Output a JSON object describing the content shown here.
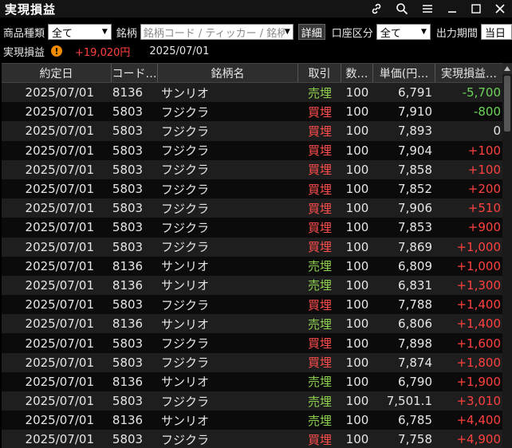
{
  "window": {
    "title": "実現損益",
    "icons": [
      "link-icon",
      "search-icon",
      "menu-icon",
      "minimize-icon",
      "maximize-icon",
      "close-icon"
    ]
  },
  "filters": {
    "product_label": "商品種類",
    "product_value": "全て",
    "symbol_label": "銘柄",
    "symbol_placeholder": "銘柄コード / ティッカー / 銘柄名",
    "detail_button": "詳細",
    "account_label": "口座区分",
    "account_value": "全て",
    "period_label": "出力期間",
    "period_value": "当日"
  },
  "summary": {
    "label": "実現損益",
    "value": "+19,020円",
    "date": "2025/07/01"
  },
  "colors": {
    "sell": "#8fd14f",
    "buy": "#ff4d4d",
    "profit": "#ff4040",
    "loss": "#6ed35a"
  },
  "table": {
    "headers": [
      "約定日",
      "コード…",
      "銘柄名",
      "取引",
      "数…",
      "単価(円…",
      "実現損益…"
    ],
    "rows": [
      {
        "date": "2025/07/01",
        "code": "8136",
        "name": "サンリオ",
        "side": "売埋",
        "qty": "100",
        "price": "6,791",
        "pnl": "-5,700"
      },
      {
        "date": "2025/07/01",
        "code": "5803",
        "name": "フジクラ",
        "side": "買埋",
        "qty": "100",
        "price": "7,910",
        "pnl": "-800"
      },
      {
        "date": "2025/07/01",
        "code": "5803",
        "name": "フジクラ",
        "side": "買埋",
        "qty": "100",
        "price": "7,893",
        "pnl": "0"
      },
      {
        "date": "2025/07/01",
        "code": "5803",
        "name": "フジクラ",
        "side": "買埋",
        "qty": "100",
        "price": "7,904",
        "pnl": "+100"
      },
      {
        "date": "2025/07/01",
        "code": "5803",
        "name": "フジクラ",
        "side": "買埋",
        "qty": "100",
        "price": "7,858",
        "pnl": "+100"
      },
      {
        "date": "2025/07/01",
        "code": "5803",
        "name": "フジクラ",
        "side": "買埋",
        "qty": "100",
        "price": "7,852",
        "pnl": "+200"
      },
      {
        "date": "2025/07/01",
        "code": "5803",
        "name": "フジクラ",
        "side": "買埋",
        "qty": "100",
        "price": "7,906",
        "pnl": "+510"
      },
      {
        "date": "2025/07/01",
        "code": "5803",
        "name": "フジクラ",
        "side": "買埋",
        "qty": "100",
        "price": "7,853",
        "pnl": "+900"
      },
      {
        "date": "2025/07/01",
        "code": "5803",
        "name": "フジクラ",
        "side": "買埋",
        "qty": "100",
        "price": "7,869",
        "pnl": "+1,000"
      },
      {
        "date": "2025/07/01",
        "code": "8136",
        "name": "サンリオ",
        "side": "売埋",
        "qty": "100",
        "price": "6,809",
        "pnl": "+1,000"
      },
      {
        "date": "2025/07/01",
        "code": "8136",
        "name": "サンリオ",
        "side": "売埋",
        "qty": "100",
        "price": "6,831",
        "pnl": "+1,300"
      },
      {
        "date": "2025/07/01",
        "code": "5803",
        "name": "フジクラ",
        "side": "買埋",
        "qty": "100",
        "price": "7,788",
        "pnl": "+1,400"
      },
      {
        "date": "2025/07/01",
        "code": "8136",
        "name": "サンリオ",
        "side": "売埋",
        "qty": "100",
        "price": "6,806",
        "pnl": "+1,400"
      },
      {
        "date": "2025/07/01",
        "code": "5803",
        "name": "フジクラ",
        "side": "買埋",
        "qty": "100",
        "price": "7,898",
        "pnl": "+1,600"
      },
      {
        "date": "2025/07/01",
        "code": "5803",
        "name": "フジクラ",
        "side": "買埋",
        "qty": "100",
        "price": "7,874",
        "pnl": "+1,800"
      },
      {
        "date": "2025/07/01",
        "code": "8136",
        "name": "サンリオ",
        "side": "売埋",
        "qty": "100",
        "price": "6,790",
        "pnl": "+1,900"
      },
      {
        "date": "2025/07/01",
        "code": "5803",
        "name": "フジクラ",
        "side": "売埋",
        "qty": "100",
        "price": "7,501.1",
        "pnl": "+3,010"
      },
      {
        "date": "2025/07/01",
        "code": "8136",
        "name": "サンリオ",
        "side": "売埋",
        "qty": "100",
        "price": "6,785",
        "pnl": "+4,400"
      },
      {
        "date": "2025/07/01",
        "code": "5803",
        "name": "フジクラ",
        "side": "買埋",
        "qty": "100",
        "price": "7,758",
        "pnl": "+4,900"
      }
    ]
  }
}
